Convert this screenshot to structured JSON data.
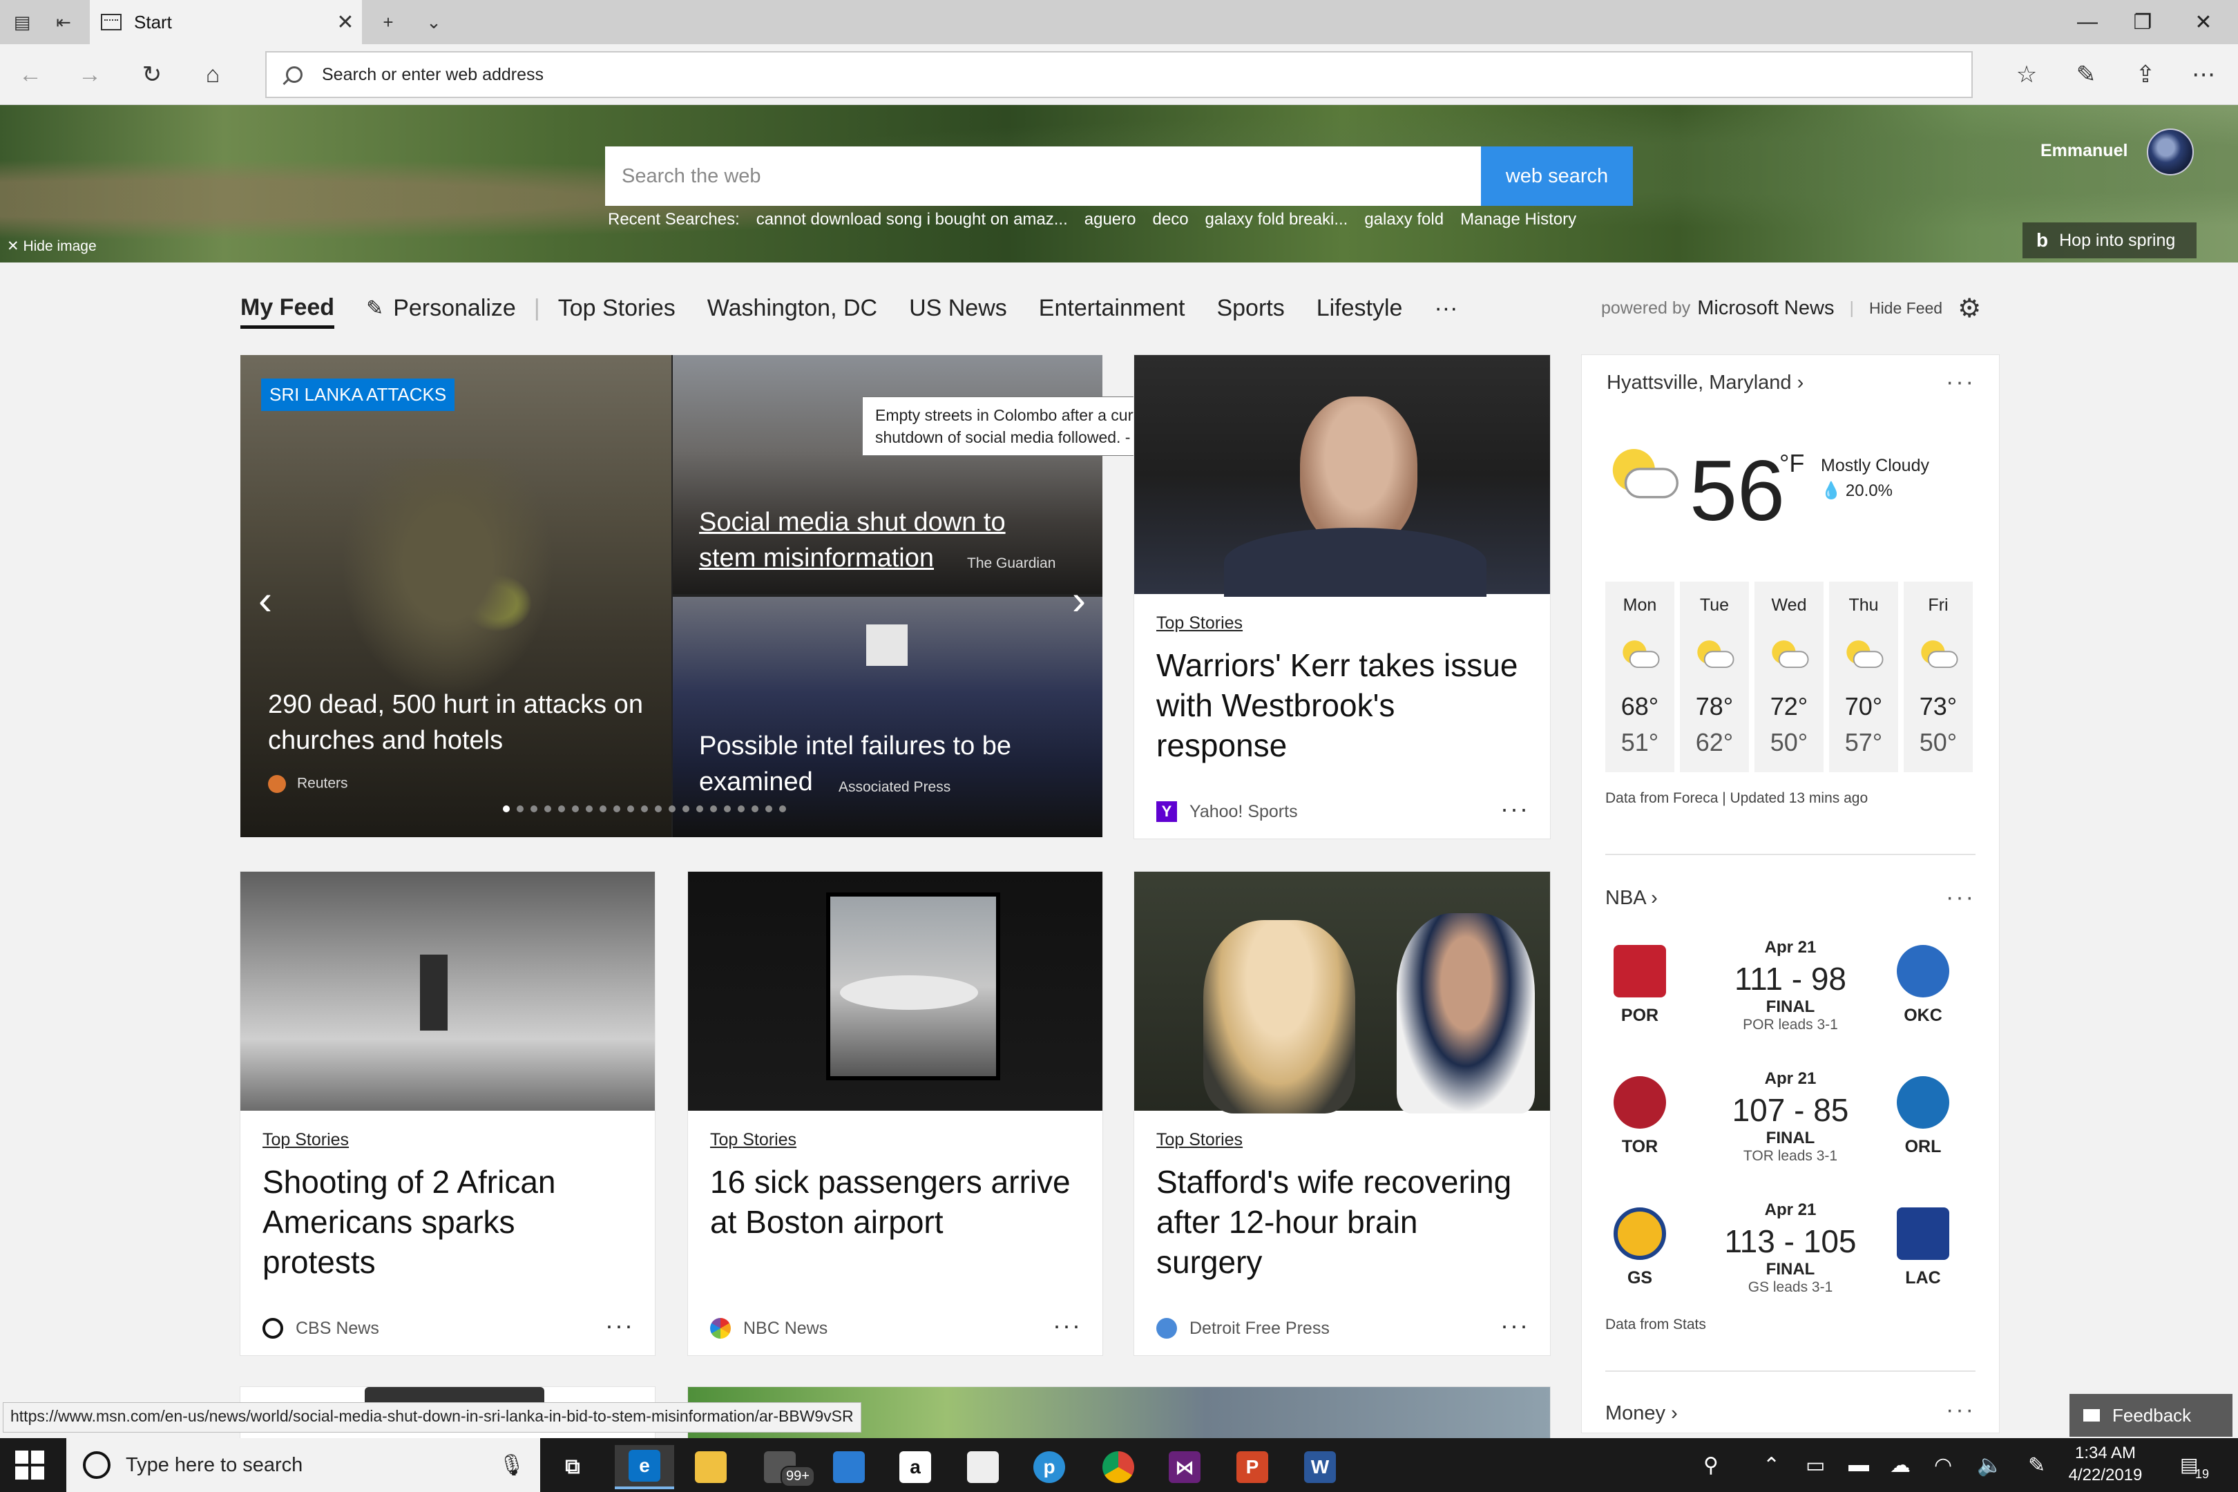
{
  "browser": {
    "tab_title": "Start",
    "address_placeholder": "Search or enter web address",
    "status_url": "https://www.msn.com/en-us/news/world/social-media-shut-down-in-sri-lanka-in-bid-to-stem-misinformation/ar-BBW9vSR"
  },
  "hero": {
    "search_placeholder": "Search the web",
    "search_button": "web search",
    "recent_label": "Recent Searches:",
    "recent_items": [
      "cannot download song i bought on amaz...",
      "aguero",
      "deco",
      "galaxy fold breaki...",
      "galaxy fold"
    ],
    "manage_history": "Manage History",
    "user_name": "Emmanuel",
    "hide_image": "Hide image",
    "hop_label": "Hop into spring"
  },
  "feed_nav": {
    "active": "My Feed",
    "personalize": "Personalize",
    "items": [
      "Top Stories",
      "Washington, DC",
      "US News",
      "Entertainment",
      "Sports",
      "Lifestyle"
    ],
    "more": "···",
    "powered_by": "powered by",
    "powered_brand": "Microsoft News",
    "hide_feed": "Hide Feed"
  },
  "carousel": {
    "badge": "SRI LANKA ATTACKS",
    "main_headline": "290 dead, 500 hurt in attacks on churches and hotels",
    "main_source": "Reuters",
    "top_headline": "Social media shut down to stem misinformation",
    "top_source": "The Guardian",
    "bottom_headline": "Possible intel failures to be examined",
    "bottom_source": "Associated Press",
    "tooltip": "Empty streets in Colombo after a curfew was imposed. A shutdown of social media followed. - AFP/Getty Images",
    "dot_count": 21,
    "active_dot": 0
  },
  "cards": {
    "kerr": {
      "category": "Top Stories",
      "headline": "Warriors' Kerr takes issue with Westbrook's response",
      "source": "Yahoo! Sports"
    },
    "shooting": {
      "category": "Top Stories",
      "headline": "Shooting of 2 African Americans sparks protests",
      "source": "CBS News"
    },
    "airport": {
      "category": "Top Stories",
      "headline": "16 sick passengers arrive at Boston airport",
      "source": "NBC News"
    },
    "stafford": {
      "category": "Top Stories",
      "headline": "Stafford's wife recovering after 12-hour brain surgery",
      "source": "Detroit Free Press"
    },
    "more_label": "···"
  },
  "weather": {
    "location": "Hyattsville, Maryland",
    "temp": "56",
    "unit": "°F",
    "condition": "Mostly Cloudy",
    "precip": "20.0%",
    "forecast": [
      {
        "day": "Mon",
        "hi": "68°",
        "lo": "51°"
      },
      {
        "day": "Tue",
        "hi": "78°",
        "lo": "62°"
      },
      {
        "day": "Wed",
        "hi": "72°",
        "lo": "50°"
      },
      {
        "day": "Thu",
        "hi": "70°",
        "lo": "57°"
      },
      {
        "day": "Fri",
        "hi": "73°",
        "lo": "50°"
      }
    ],
    "note": "Data from Foreca | Updated 13 mins ago"
  },
  "nba": {
    "title": "NBA",
    "games": [
      {
        "date": "Apr 21",
        "score": "111 - 98",
        "status": "FINAL",
        "series": "POR leads 3-1",
        "home": "POR",
        "away": "OKC",
        "home_color": "#c4202f",
        "away_color": "#2a6bc1"
      },
      {
        "date": "Apr 21",
        "score": "107 - 85",
        "status": "FINAL",
        "series": "TOR leads 3-1",
        "home": "TOR",
        "away": "ORL",
        "home_color": "#b01e2d",
        "away_color": "#1b6fb8"
      },
      {
        "date": "Apr 21",
        "score": "113 - 105",
        "status": "FINAL",
        "series": "GS leads 3-1",
        "home": "GS",
        "away": "LAC",
        "home_color": "#f3b820",
        "away_color": "#1d3f8f"
      }
    ],
    "note": "Data from Stats"
  },
  "money": {
    "title": "Money"
  },
  "feedback": "Feedback",
  "taskbar": {
    "search_placeholder": "Type here to search",
    "badge_count": "99+",
    "time": "1:34 AM",
    "date": "4/22/2019",
    "notification_count": "19"
  }
}
